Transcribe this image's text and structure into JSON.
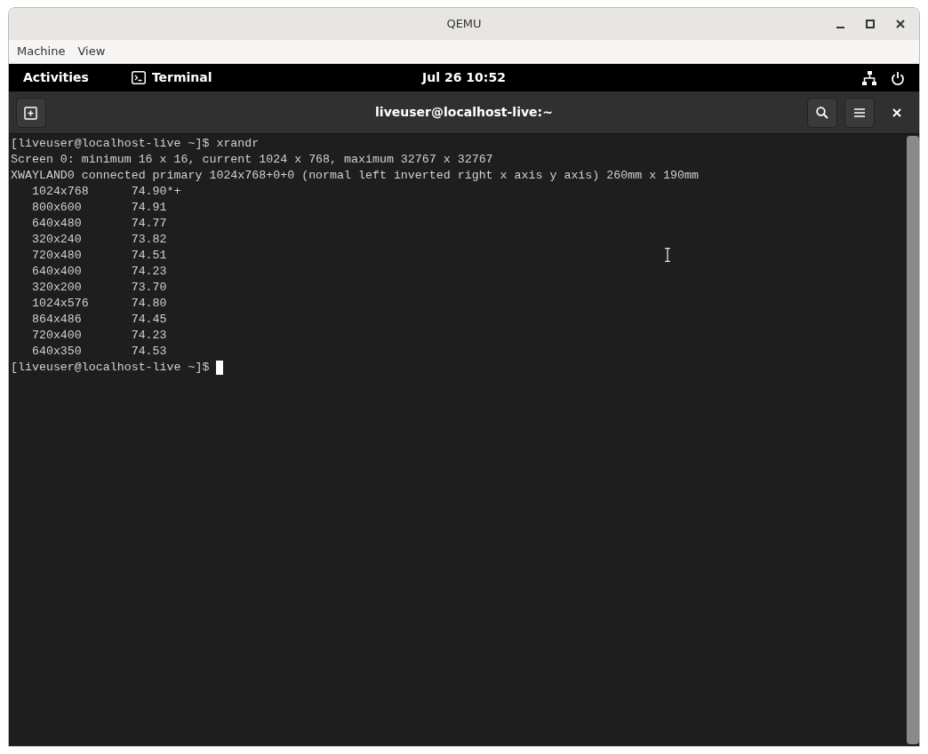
{
  "window": {
    "title": "QEMU"
  },
  "menu": [
    "Machine",
    "View"
  ],
  "top_bar": {
    "activities": "Activities",
    "app": "Terminal",
    "clock": "Jul 26  10:52"
  },
  "terminal": {
    "title": "liveuser@localhost-live:~",
    "lines": [
      "[liveuser@localhost-live ~]$ xrandr",
      "Screen 0: minimum 16 x 16, current 1024 x 768, maximum 32767 x 32767",
      "XWAYLAND0 connected primary 1024x768+0+0 (normal left inverted right x axis y axis) 260mm x 190mm",
      "   1024x768      74.90*+",
      "   800x600       74.91",
      "   640x480       74.77",
      "   320x240       73.82",
      "   720x480       74.51",
      "   640x400       74.23",
      "   320x200       73.70",
      "   1024x576      74.80",
      "   864x486       74.45",
      "   720x400       74.23",
      "   640x350       74.53"
    ],
    "prompt": "[liveuser@localhost-live ~]$ "
  }
}
